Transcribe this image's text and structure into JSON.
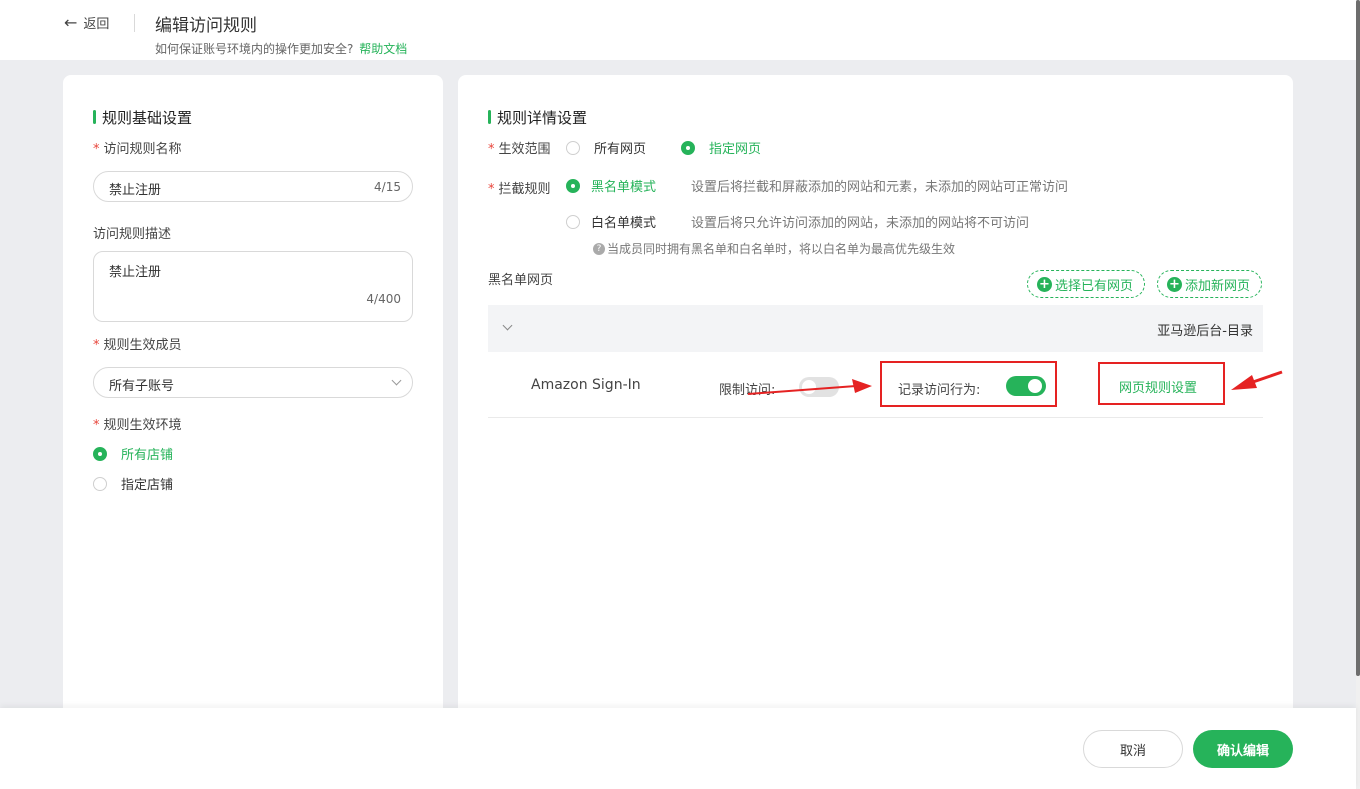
{
  "header": {
    "back_label": "返回",
    "title": "编辑访问规则",
    "subtitle": "如何保证账号环境内的操作更加安全?",
    "help_link": "帮助文档"
  },
  "left_card": {
    "section_title": "规则基础设置",
    "name_field": {
      "label": "访问规则名称",
      "value": "禁止注册",
      "count": "4/15"
    },
    "desc_field": {
      "label": "访问规则描述",
      "value": "禁止注册",
      "count": "4/400"
    },
    "members_field": {
      "label": "规则生效成员",
      "value": "所有子账号"
    },
    "env_field": {
      "label": "规则生效环境",
      "options": [
        {
          "label": "所有店铺",
          "selected": true
        },
        {
          "label": "指定店铺",
          "selected": false
        }
      ]
    }
  },
  "right_card": {
    "section_title": "规则详情设置",
    "scope": {
      "label": "生效范围",
      "options": [
        {
          "label": "所有网页",
          "selected": false
        },
        {
          "label": "指定网页",
          "selected": true
        }
      ]
    },
    "intercept": {
      "label": "拦截规则",
      "options": [
        {
          "label": "黑名单模式",
          "selected": true,
          "desc": "设置后将拦截和屏蔽添加的网站和元素，未添加的网站可正常访问"
        },
        {
          "label": "白名单模式",
          "selected": false,
          "desc": "设置后将只允许访问添加的网站，未添加的网站将不可访问"
        }
      ],
      "note": "当成员同时拥有黑名单和白名单时，将以白名单为最高优先级生效"
    },
    "blacklist_label": "黑名单网页",
    "select_existing_btn": "选择已有网页",
    "add_new_btn": "添加新网页",
    "group_title": "亚马逊后台-目录",
    "row": {
      "site": "Amazon Sign-In",
      "restrict_label": "限制访问:",
      "restrict_on": false,
      "record_label": "记录访问行为:",
      "record_on": true,
      "rule_link": "网页规则设置"
    }
  },
  "footer": {
    "cancel": "取消",
    "confirm": "确认编辑"
  },
  "colors": {
    "accent": "#26b35a",
    "annotation": "#e52222"
  }
}
